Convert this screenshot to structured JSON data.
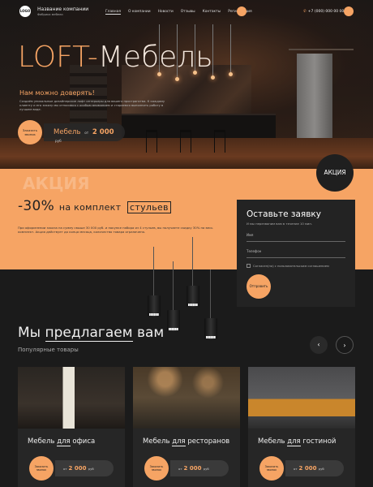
{
  "header": {
    "logo_text": "LOGO",
    "company_name": "Название компании",
    "company_tagline": "Фабрика мебели",
    "nav": [
      "Главная",
      "О компании",
      "Новости",
      "Отзывы",
      "Контакты",
      "Регистрация"
    ],
    "phone": "+7 (000) 000 00 00"
  },
  "hero": {
    "title_accent": "LOFT-",
    "title_main": "Мебель",
    "subtitle": "Нам можно доверять!",
    "description": "Создаём уникальные дизайнерские лофт интерьеры для вашего пространства. К каждому клиенту и его заказу мы относимся с особым вниманием и стараемся выполнить работу в лучшем виде.",
    "cta_label": "Заказать звонок",
    "price_prefix": "Мебель",
    "price_from": "от",
    "price_value": "2 000",
    "price_unit": "руб"
  },
  "promo": {
    "badge": "АКЦИЯ",
    "ghost_text": "АКЦИЯ",
    "title_part1": "-30%",
    "title_part2": "на комплект",
    "title_part3": "стульев",
    "description": "При оформлении заказа на сумму свыше 30 000 руб. и покупке набора из 4 стульев, вы получаете скидку 30% на весь комплект. Акция действует до конца месяца, количество товара ограничено."
  },
  "form": {
    "title": "Оставьте заявку",
    "subtitle": "И мы перезвоним вам в течение 10 мин.",
    "name_placeholder": "Имя",
    "phone_placeholder": "Телефон",
    "consent": "Согласен(на) с пользовательским соглашением",
    "submit": "Отправить"
  },
  "offers": {
    "title_part1": "Мы",
    "title_part2": "предлагаем",
    "title_part3": "вам",
    "subtitle": "Популярные товары",
    "prev": "‹",
    "next": "›",
    "cards": [
      {
        "name": "Мебель",
        "hl": "для",
        "target": "офиса",
        "button": "Заказать звонок",
        "from": "от",
        "price": "2 000",
        "unit": "руб"
      },
      {
        "name": "Мебель",
        "hl": "для",
        "target": "ресторанов",
        "button": "Заказать звонок",
        "from": "от",
        "price": "2 000",
        "unit": "руб"
      },
      {
        "name": "Мебель",
        "hl": "для",
        "target": "гостиной",
        "button": "Заказать звонок",
        "from": "от",
        "price": "2 000",
        "unit": "руб"
      }
    ]
  },
  "colors": {
    "accent": "#f6a464",
    "dark": "#1b1b1b",
    "panel": "#232323"
  }
}
